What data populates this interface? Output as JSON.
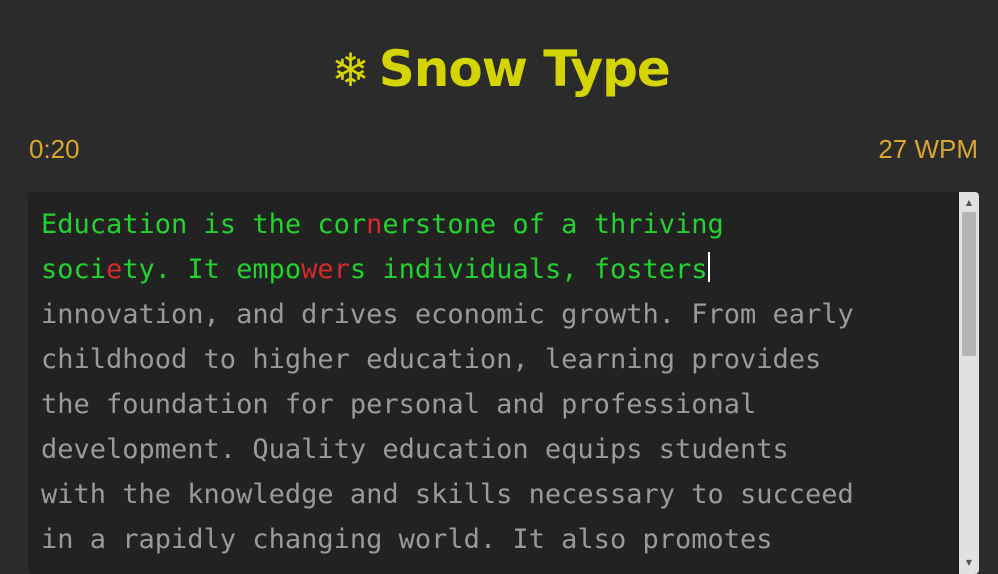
{
  "app": {
    "title": "Snow Type",
    "logo_icon": "snowflake-icon",
    "logo_glyph": "❄",
    "brand_color": "#d4d400"
  },
  "stats": {
    "timer": "0:20",
    "wpm": "27 WPM",
    "stats_color": "#d9a72e"
  },
  "typing": {
    "status_colors": {
      "correct": "#22d22e",
      "error": "#d42a2a",
      "pending": "#9a9a9a"
    },
    "lines": [
      [
        {
          "t": "Education is the cor",
          "s": "c"
        },
        {
          "t": "n",
          "s": "e"
        },
        {
          "t": "erstone of a thriving",
          "s": "c"
        }
      ],
      [
        {
          "t": "soci",
          "s": "c"
        },
        {
          "t": "e",
          "s": "e"
        },
        {
          "t": "ty. It empo",
          "s": "c"
        },
        {
          "t": "wer",
          "s": "e"
        },
        {
          "t": "s individuals, fosters",
          "s": "c"
        },
        {
          "caret": true
        },
        {
          "t": " ",
          "s": "p"
        }
      ],
      [
        {
          "t": "innovation, and drives economic growth. From early",
          "s": "p"
        }
      ],
      [
        {
          "t": "childhood to higher education, learning provides",
          "s": "p"
        }
      ],
      [
        {
          "t": "the foundation for personal and professional",
          "s": "p"
        }
      ],
      [
        {
          "t": "development. Quality education equips students",
          "s": "p"
        }
      ],
      [
        {
          "t": "with the knowledge and skills necessary to succeed",
          "s": "p"
        }
      ],
      [
        {
          "t": "in a rapidly changing world. It also promotes",
          "s": "p"
        }
      ]
    ]
  },
  "scrollbar": {
    "up_icon": "arrow-up-icon",
    "down_icon": "arrow-down-icon",
    "up_glyph": "▲",
    "down_glyph": "▼",
    "scroll_position": 0.0
  }
}
